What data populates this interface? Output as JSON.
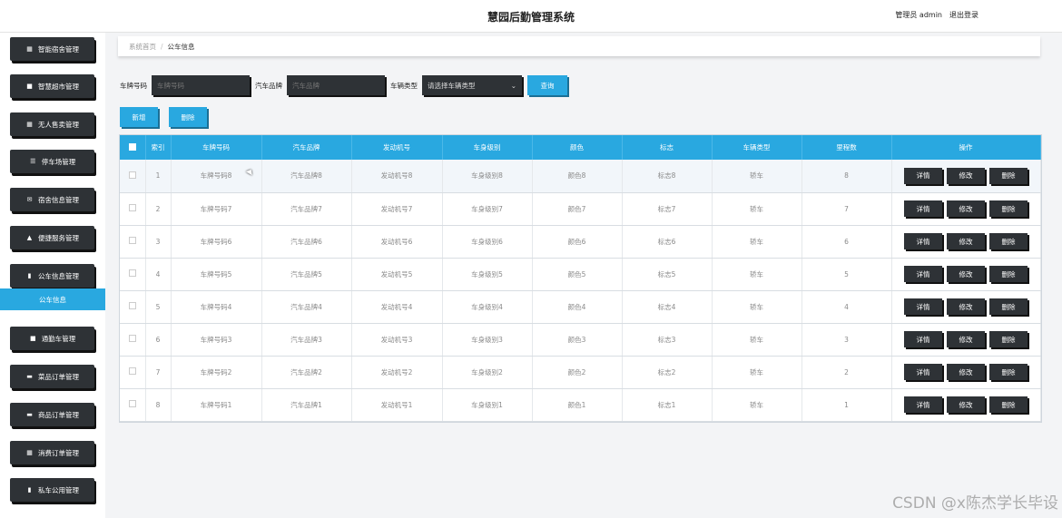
{
  "header": {
    "title": "慧园后勤管理系统",
    "user": "管理员 admin",
    "logout": "退出登录"
  },
  "sidebar": {
    "items": [
      {
        "icon": "grid-icon",
        "label": "智能宿舍管理"
      },
      {
        "icon": "store-icon",
        "label": "智慧超市管理"
      },
      {
        "icon": "grid-icon",
        "label": "无人售卖管理"
      },
      {
        "icon": "menu-icon",
        "label": "停车场管理"
      },
      {
        "icon": "envelope-icon",
        "label": "宿舍信息管理"
      },
      {
        "icon": "thumb-icon",
        "label": "便捷服务管理"
      },
      {
        "icon": "bag-icon",
        "label": "公车信息管理"
      },
      {
        "icon": "square-icon",
        "label": "通勤车管理"
      },
      {
        "icon": "comment-icon",
        "label": "菜品订单管理"
      },
      {
        "icon": "comment-icon",
        "label": "商品订单管理"
      },
      {
        "icon": "grid-icon",
        "label": "消费订单管理"
      },
      {
        "icon": "bag-icon",
        "label": "私车公用管理"
      }
    ],
    "active_sub": "公车信息"
  },
  "breadcrumb": {
    "home": "系统首页",
    "separator": "/",
    "current": "公车信息"
  },
  "search": {
    "plate_label": "车牌号码",
    "plate_placeholder": "车牌号码",
    "brand_label": "汽车品牌",
    "brand_placeholder": "汽车品牌",
    "type_label": "车辆类型",
    "type_placeholder": "请选择车辆类型",
    "query": "查询"
  },
  "actions": {
    "add": "新增",
    "delete": "删除"
  },
  "table": {
    "columns": [
      "索引",
      "车牌号码",
      "汽车品牌",
      "发动机号",
      "车身级别",
      "颜色",
      "标志",
      "车辆类型",
      "里程数",
      "操作"
    ],
    "rows": [
      [
        "1",
        "车牌号码8",
        "汽车品牌8",
        "发动机号8",
        "车身级别8",
        "颜色8",
        "标志8",
        "轿车",
        "8"
      ],
      [
        "2",
        "车牌号码7",
        "汽车品牌7",
        "发动机号7",
        "车身级别7",
        "颜色7",
        "标志7",
        "轿车",
        "7"
      ],
      [
        "3",
        "车牌号码6",
        "汽车品牌6",
        "发动机号6",
        "车身级别6",
        "颜色6",
        "标志6",
        "轿车",
        "6"
      ],
      [
        "4",
        "车牌号码5",
        "汽车品牌5",
        "发动机号5",
        "车身级别5",
        "颜色5",
        "标志5",
        "轿车",
        "5"
      ],
      [
        "5",
        "车牌号码4",
        "汽车品牌4",
        "发动机号4",
        "车身级别4",
        "颜色4",
        "标志4",
        "轿车",
        "4"
      ],
      [
        "6",
        "车牌号码3",
        "汽车品牌3",
        "发动机号3",
        "车身级别3",
        "颜色3",
        "标志3",
        "轿车",
        "3"
      ],
      [
        "7",
        "车牌号码2",
        "汽车品牌2",
        "发动机号2",
        "车身级别2",
        "颜色2",
        "标志2",
        "轿车",
        "2"
      ],
      [
        "8",
        "车牌号码1",
        "汽车品牌1",
        "发动机号1",
        "车身级别1",
        "颜色1",
        "标志1",
        "轿车",
        "1"
      ]
    ],
    "row_actions": [
      "详情",
      "修改",
      "删除"
    ]
  },
  "watermark": "CSDN @x陈杰学长毕设",
  "colors": {
    "accent": "#29a8e0",
    "dark": "#2e3236"
  }
}
